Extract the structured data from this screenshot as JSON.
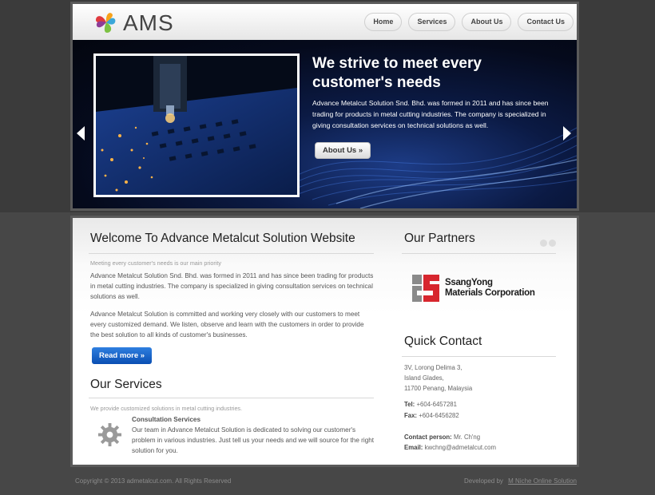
{
  "logo": {
    "text": "AMS"
  },
  "nav": {
    "items": [
      "Home",
      "Services",
      "About Us",
      "Contact Us"
    ]
  },
  "banner": {
    "title": "We strive to meet every customer's needs",
    "text": "Advance Metalcut Solution Snd. Bhd. was formed in 2011 and has since been trading for products in metal cutting industries. The company is specialized in giving consultation services on technical solutions as well.",
    "button_label": "About Us »"
  },
  "welcome": {
    "title": "Welcome To Advance Metalcut Solution Website",
    "subtitle": "Meeting every customer's needs is our main priority",
    "para1": "Advance Metalcut Solution Snd. Bhd. was formed in 2011 and has since been trading for products in metal cutting industries. The company is specialized in giving consultation services on technical solutions as well.",
    "para2": "Advance Metalcut Solution is committed and working very closely with our customers to meet every customized demand. We listen, observe and learn with the customers in order to provide the best solution to all kinds of customer's businesses.",
    "read_more": "Read more »"
  },
  "services": {
    "title": "Our Services",
    "subtitle": "We provide customized solutions in metal cutting industries.",
    "item_title": "Consultation Services",
    "item_text": "Our team in Advance Metalcut Solution is dedicated to solving our customer's problem in various industries. Just tell us your needs and we will source for the right solution for you."
  },
  "partners": {
    "title": "Our Partners",
    "partner_name_line1": "SsangYong",
    "partner_name_line2": "Materials Corporation"
  },
  "contact": {
    "title": "Quick Contact",
    "address1": "3V, Lorong Delima 3,",
    "address2": "Island Glades,",
    "address3": "11700 Penang, Malaysia",
    "tel_label": "Tel:",
    "tel": "+604-6457281",
    "fax_label": "Fax:",
    "fax": "+604-6456282",
    "person_label": "Contact person:",
    "person": "Mr. Ch'ng",
    "email_label": "Email:",
    "email": "kwchng@admetalcut.com"
  },
  "footer": {
    "copyright": "Copyright © 2013 admetalcut.com. All Rights Reserved",
    "developed_by": "Developed by",
    "developer": "M Niche Online Solution"
  },
  "colors": {
    "accent_blue": "#0a4fb3",
    "partner_red": "#d7262e",
    "page_bg": "#474747"
  }
}
